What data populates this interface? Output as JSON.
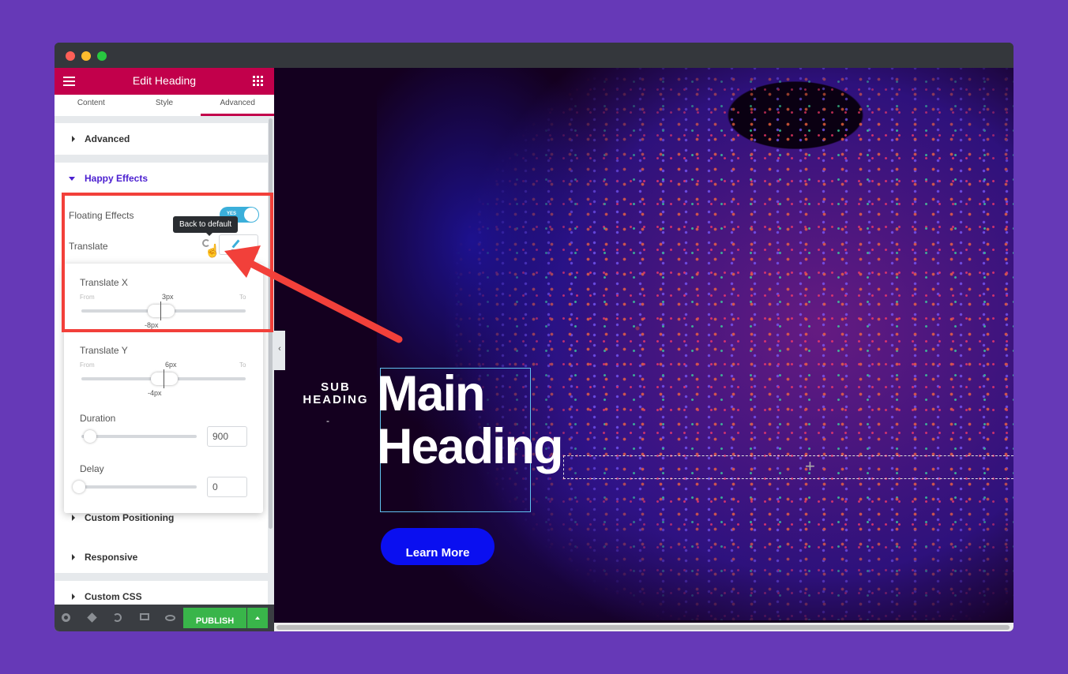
{
  "window": {
    "controls": [
      "close",
      "minimize",
      "maximize"
    ]
  },
  "sidebar": {
    "header": {
      "title": "Edit Heading",
      "menu_icon": "hamburger-icon",
      "grid_icon": "apps-grid-icon"
    },
    "tabs": [
      {
        "label": "Content",
        "active": false
      },
      {
        "label": "Style",
        "active": false
      },
      {
        "label": "Advanced",
        "active": true
      }
    ],
    "sections": {
      "advanced": "Advanced",
      "happy_effects": "Happy Effects",
      "custom_positioning": "Custom Positioning",
      "responsive": "Responsive",
      "custom_css": "Custom CSS"
    },
    "floating_effects": {
      "label": "Floating Effects",
      "toggle_text": "YES",
      "enabled": true
    },
    "translate": {
      "label": "Translate",
      "tooltip": "Back to default"
    },
    "popover": {
      "translate_x": {
        "title": "Translate X",
        "from_label": "From",
        "to_label": "To",
        "to_value": "3px",
        "from_value": "-8px"
      },
      "translate_y": {
        "title": "Translate Y",
        "from_label": "From",
        "to_label": "To",
        "to_value": "6px",
        "from_value": "-4px"
      },
      "duration": {
        "title": "Duration",
        "value": "900"
      },
      "delay": {
        "title": "Delay",
        "value": "0"
      }
    },
    "footer": {
      "icons": [
        "settings-icon",
        "navigator-layers-icon",
        "history-icon",
        "responsive-desktop-icon",
        "preview-eye-icon"
      ],
      "publish_label": "PUBLISH"
    }
  },
  "canvas": {
    "sub_heading": "SUB HEADING",
    "sub_dash": "-",
    "main_heading_line1": "Main",
    "main_heading_line2": "Heading",
    "button_label": "Learn More",
    "collapse_glyph": "‹",
    "add_glyph": "+"
  },
  "colors": {
    "brand": "#c2004b",
    "happy_effects": "#4b1fd0",
    "publish": "#39b54a",
    "toggle": "#3bafda",
    "button": "#0a0ff0",
    "annotation": "#f2403a",
    "background": "#6639b7"
  }
}
